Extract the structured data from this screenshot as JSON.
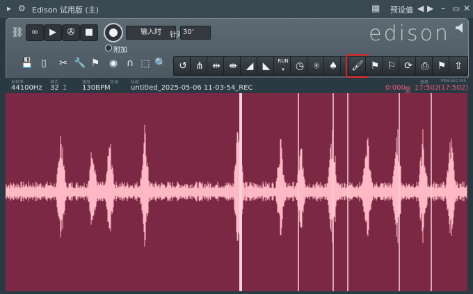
{
  "window": {
    "title": "Edison 试用版 (主)",
    "preset_label": "预设值",
    "colors": {
      "accent_red": "#e0201f",
      "waveform_bg": "#7a2843",
      "waveform": "#ffb8c4"
    }
  },
  "transport": {
    "input_label": "输入时",
    "threshold_label": "针对",
    "threshold_value": "30'",
    "append_label": "附加"
  },
  "logo": {
    "text": "edison"
  },
  "info": {
    "captions": [
      "采样率",
      "格式",
      "速度",
      "音调",
      "标题",
      "选择",
      "MIN:SEC:MS"
    ],
    "sample_rate": "44100Hz",
    "bit_depth": "32",
    "tempo": "130BPM",
    "filename": "untitled_2025-05-06 11-03-54_REC",
    "selection_start": "0:000",
    "selection_to": "至",
    "selection_end": "17:502",
    "selection_length": "(17:502)"
  },
  "icons": {
    "left": [
      "link-icon",
      "loop-icon",
      "play-icon",
      "reel-icon",
      "stop-icon",
      "record-icon"
    ],
    "toolbar_left": [
      "save-icon",
      "new-file-icon",
      "cut-icon",
      "wrench-icon",
      "marker-flag-icon",
      "eye-icon",
      "magnet-icon",
      "selection-icon",
      "zoom-icon"
    ],
    "toolbar_fx": [
      "reverse-icon",
      "pitch-icon",
      "stretch-icon",
      "fade-in-icon",
      "fade-out-icon",
      "run-icon",
      "clock-icon",
      "clip-icon",
      "blend-icon",
      "spectrum-icon",
      "brush-icon",
      "marker-add-icon",
      "marker-tool-icon",
      "loop-sync-icon",
      "save-regions-icon",
      "send-icon",
      "export-icon"
    ]
  }
}
